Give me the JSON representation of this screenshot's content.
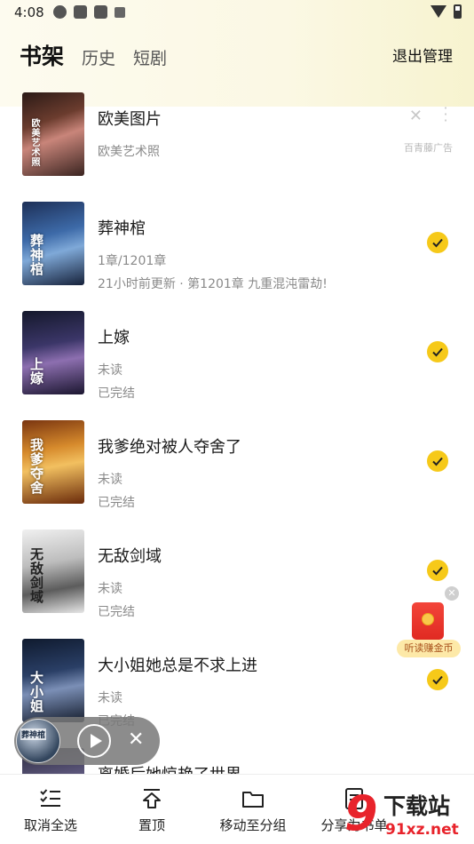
{
  "status_bar": {
    "time": "4:08"
  },
  "header": {
    "tabs": [
      {
        "label": "书架",
        "active": true
      },
      {
        "label": "历史",
        "active": false
      },
      {
        "label": "短剧",
        "active": false
      }
    ],
    "exit_manage": "退出管理"
  },
  "ad": {
    "title": "欧美图片",
    "subtitle": "欧美艺术照",
    "tag": "百青藤广告",
    "cover_text": "欧美艺术照"
  },
  "books": [
    {
      "title": "葬神棺",
      "meta1": "1章/1201章",
      "meta2": "21小时前更新 · 第1201章 九重混沌雷劫!",
      "cover_text": "葬神棺",
      "selected": true
    },
    {
      "title": "上嫁",
      "meta1": "未读",
      "meta2": "已完结",
      "cover_text": "上嫁",
      "selected": true
    },
    {
      "title": "我爹绝对被人夺舍了",
      "meta1": "未读",
      "meta2": "已完结",
      "cover_text": "我爹夺舍",
      "selected": true
    },
    {
      "title": "无敌剑域",
      "meta1": "未读",
      "meta2": "已完结",
      "cover_text": "无敌剑域",
      "selected": true
    },
    {
      "title": "大小姐她总是不求上进",
      "meta1": "未读",
      "meta2": "已完结",
      "cover_text": "大小姐",
      "selected": true
    },
    {
      "title": "离婚后她惊艳了世界",
      "meta1": "",
      "meta2": "",
      "cover_text": "",
      "selected": false
    }
  ],
  "redpacket": {
    "label": "听读赚金币"
  },
  "mini_player": {
    "cover_text": "葬神棺"
  },
  "toolbar": {
    "items": [
      {
        "label": "取消全选",
        "icon": "checklist-icon"
      },
      {
        "label": "置顶",
        "icon": "pin-top-icon"
      },
      {
        "label": "移动至分组",
        "icon": "folder-icon"
      },
      {
        "label": "分享为书单",
        "icon": "document-icon"
      }
    ]
  },
  "watermark": {
    "brand": "下载站",
    "url": "91xz.net"
  },
  "colors": {
    "accent": "#f6c919",
    "tab_underline": "#f8d22a",
    "watermark_red": "#e8232b"
  }
}
